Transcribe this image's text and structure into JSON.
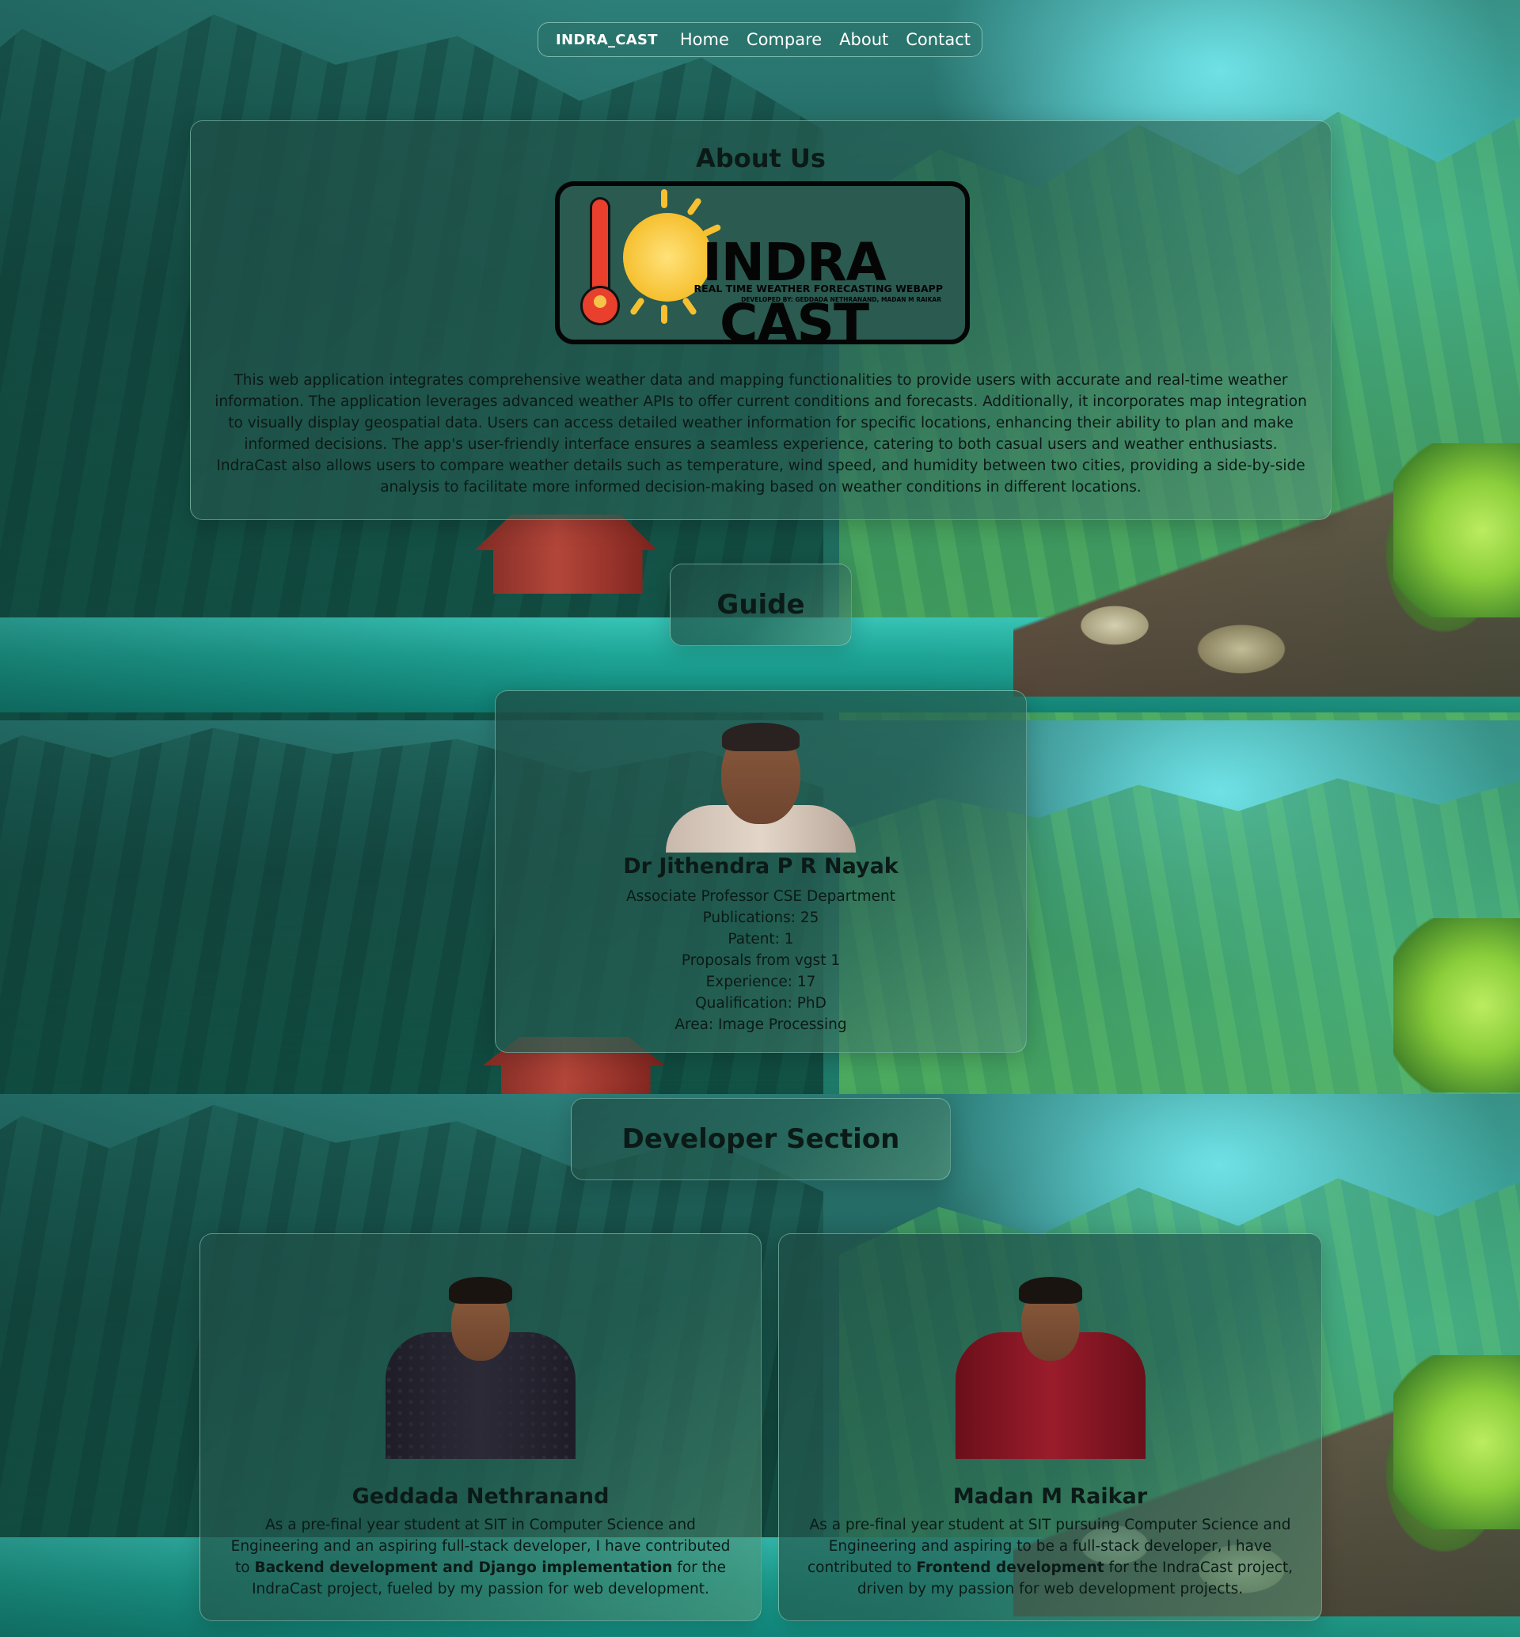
{
  "nav": {
    "brand": "INDRA_CAST",
    "links": [
      "Home",
      "Compare",
      "About",
      "Contact"
    ]
  },
  "about": {
    "title": "About Us",
    "logo": {
      "title": "INDRA CAST",
      "tagline": "REAL TIME WEATHER FORECASTING WEBAPP",
      "developed_by": "DEVELOPED BY: GEDDADA NETHRANAND, MADAN M RAIKAR"
    },
    "description": "This web application integrates comprehensive weather data and mapping functionalities to provide users with accurate and real-time weather information. The application leverages advanced weather APIs to offer current conditions and forecasts. Additionally, it incorporates map integration to visually display geospatial data. Users can access detailed weather information for specific locations, enhancing their ability to plan and make informed decisions. The app's user-friendly interface ensures a seamless experience, catering to both casual users and weather enthusiasts. IndraCast also allows users to compare weather details such as temperature, wind speed, and humidity between two cities, providing a side-by-side analysis to facilitate more informed decision-making based on weather conditions in different locations."
  },
  "guide": {
    "heading": "Guide",
    "name": "Dr Jithendra P R Nayak",
    "details": [
      "Associate Professor CSE Department",
      "Publications: 25",
      "Patent: 1",
      "Proposals from vgst 1",
      "Experience: 17",
      "Qualification: PhD",
      "Area: Image Processing"
    ]
  },
  "developers": {
    "heading": "Developer Section",
    "dev1": {
      "name": "Geddada Nethranand",
      "bio_pre": "As a pre-final year student at SIT in Computer Science and Engineering and an aspiring full-stack developer, I have contributed to ",
      "bio_bold": "Backend development and Django implementation",
      "bio_post": " for the IndraCast project, fueled by my passion for web development."
    },
    "dev2": {
      "name": "Madan M Raikar",
      "bio_pre": "As a pre-final year student at SIT pursuing Computer Science and Engineering and aspiring to be a full-stack developer, I have contributed to ",
      "bio_bold": "Frontend development",
      "bio_post": " for the IndraCast project, driven by my passion for web development projects."
    }
  },
  "colors": {
    "card_bg": "#1e4e46",
    "card_border": "#aae6d7",
    "logo_red": "#e8402c",
    "logo_sun": "#f6c030"
  }
}
